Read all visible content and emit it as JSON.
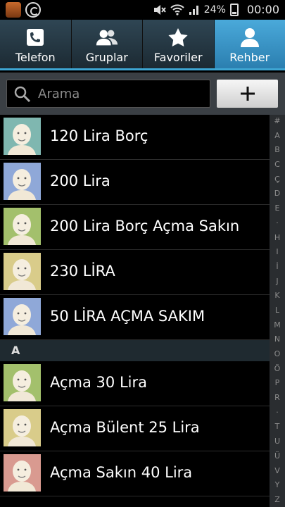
{
  "status_bar": {
    "battery": "24%",
    "time": "00:00"
  },
  "tabs": [
    {
      "label": "Telefon",
      "icon": "phone-icon",
      "active": false
    },
    {
      "label": "Gruplar",
      "icon": "group-icon",
      "active": false
    },
    {
      "label": "Favoriler",
      "icon": "star-icon",
      "active": false
    },
    {
      "label": "Rehber",
      "icon": "person-icon",
      "active": true
    }
  ],
  "search": {
    "placeholder": "Arama"
  },
  "contacts_top": [
    {
      "name": "120 Lira Borç",
      "avatar_color": "#7fb7b0"
    },
    {
      "name": "200 Lira",
      "avatar_color": "#8fa8d8"
    },
    {
      "name": "200 Lira Borç Açma Sakın",
      "avatar_color": "#a3c06c"
    },
    {
      "name": "230 LİRA",
      "avatar_color": "#d9cc8a"
    },
    {
      "name": "50 LİRA AÇMA SAKIM",
      "avatar_color": "#8fa8d8"
    }
  ],
  "section_a": {
    "letter": "A"
  },
  "contacts_a": [
    {
      "name": "Açma 30 Lira",
      "avatar_color": "#a3c06c"
    },
    {
      "name": "Açma Bülent 25 Lira",
      "avatar_color": "#d9cc8a"
    },
    {
      "name": "Açma Sakın 40 Lira",
      "avatar_color": "#d99a90"
    }
  ],
  "index_letters": [
    "#",
    "A",
    "B",
    "C",
    "Ç",
    "D",
    "E",
    "·",
    "H",
    "I",
    "İ",
    "J",
    "K",
    "L",
    "M",
    "N",
    "O",
    "Ö",
    "P",
    "R",
    "·",
    "T",
    "U",
    "Ü",
    "V",
    "Y",
    "Z"
  ]
}
